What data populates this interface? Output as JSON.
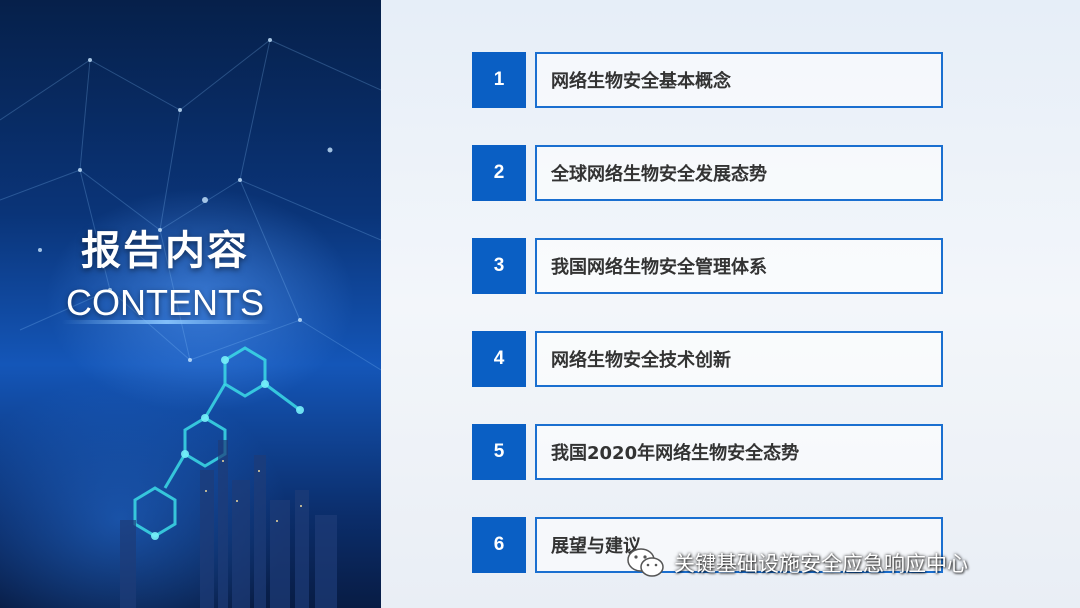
{
  "slide": {
    "title": "报告内容",
    "subtitle": "CONTENTS",
    "accent_color": "#0a5fc4",
    "toc": [
      {
        "number": "1",
        "label": "网络生物安全基本概念"
      },
      {
        "number": "2",
        "label": "全球网络生物安全发展态势"
      },
      {
        "number": "3",
        "label": "我国网络生物安全管理体系"
      },
      {
        "number": "4",
        "label": "网络生物安全技术创新"
      },
      {
        "number": "5",
        "label": "我国2020年网络生物安全态势"
      },
      {
        "number": "6",
        "label": "展望与建议"
      }
    ]
  },
  "watermark": {
    "icon": "wechat-icon",
    "text": "关键基础设施安全应急响应中心"
  }
}
